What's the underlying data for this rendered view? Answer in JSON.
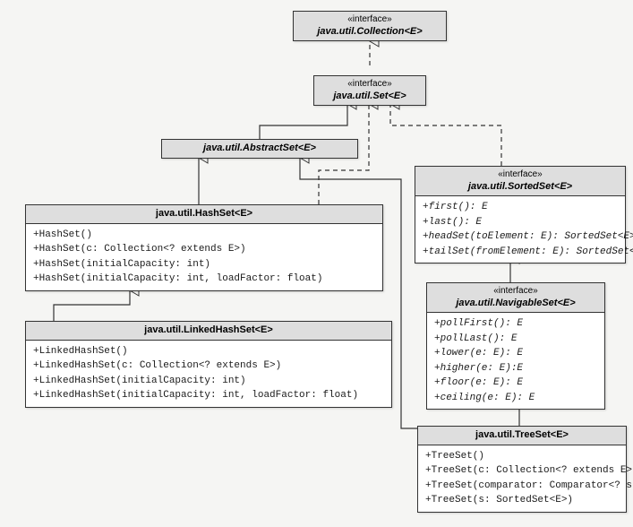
{
  "stereo": "«interface»",
  "classes": {
    "collection": {
      "name": "java.util.Collection<E>"
    },
    "set": {
      "name": "java.util.Set<E>"
    },
    "abstractset": {
      "name": "java.util.AbstractSet<E>"
    },
    "hashset": {
      "name": "java.util.HashSet<E>",
      "members": [
        "+HashSet()",
        "+HashSet(c: Collection<? extends E>)",
        "+HashSet(initialCapacity: int)",
        "+HashSet(initialCapacity: int, loadFactor: float)"
      ]
    },
    "linkedhashset": {
      "name": "java.util.LinkedHashSet<E>",
      "members": [
        "+LinkedHashSet()",
        "+LinkedHashSet(c: Collection<? extends E>)",
        "+LinkedHashSet(initialCapacity: int)",
        "+LinkedHashSet(initialCapacity: int, loadFactor: float)"
      ]
    },
    "sortedset": {
      "name": "java.util.SortedSet<E>",
      "members": [
        "+first(): E",
        "+last(): E",
        "+headSet(toElement: E): SortedSet<E>",
        "+tailSet(fromElement: E): SortedSet<E>"
      ]
    },
    "navigableset": {
      "name": "java.util.NavigableSet<E>",
      "members": [
        "+pollFirst(): E",
        "+pollLast(): E",
        "+lower(e: E): E",
        "+higher(e: E):E",
        "+floor(e: E): E",
        "+ceiling(e: E): E"
      ]
    },
    "treeset": {
      "name": "java.util.TreeSet<E>",
      "members": [
        "+TreeSet()",
        "+TreeSet(c: Collection<? extends E>)",
        "+TreeSet(comparator: Comparator<? super E>)",
        "+TreeSet(s: SortedSet<E>)"
      ]
    }
  }
}
